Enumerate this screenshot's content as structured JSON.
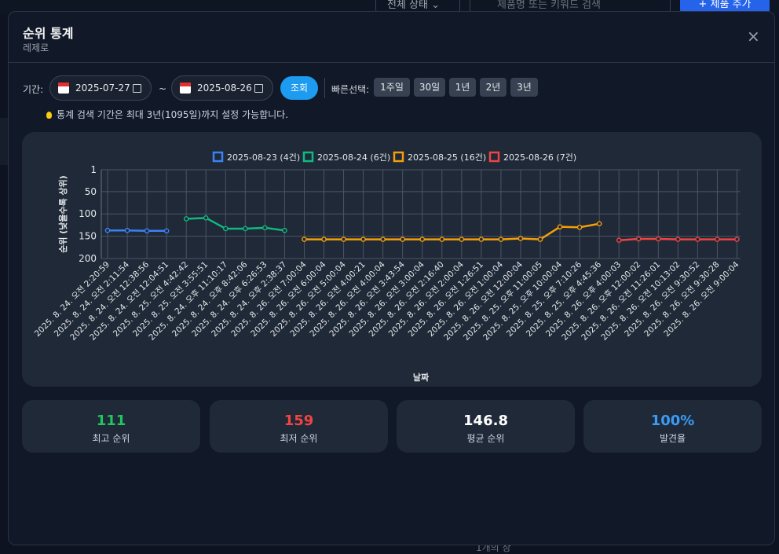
{
  "background": {
    "filter_label": "전체 상태 ⌄",
    "search_placeholder": "제품명 또는 키워드 검색",
    "add_button": "+ 제품 추가",
    "bottom_text": "1개의 상"
  },
  "modal": {
    "title": "순위 통계",
    "subtitle": "레제로",
    "close_icon": "×"
  },
  "filters": {
    "period_label": "기간:",
    "start_date": "2025-07-27",
    "end_date": "2025-08-26",
    "tilde": "~",
    "search_button": "조회",
    "quick_label": "빠른선택:",
    "quick_options": [
      "1주일",
      "30일",
      "1년",
      "2년",
      "3년"
    ],
    "hint": "통계 검색 기간은 최대 3년(1095일)까지 설정 가능합니다."
  },
  "chart_data": {
    "type": "line",
    "ylabel": "순위 (낮을수록 상위)",
    "xlabel": "날짜",
    "y_reversed": true,
    "ylim": [
      1,
      200
    ],
    "yticks": [
      1,
      50,
      100,
      150,
      200
    ],
    "grid": true,
    "legend_position": "top-center",
    "categories": [
      "2025. 8. 24. 오전 2:20:59",
      "2025. 8. 24. 오전 2:11:54",
      "2025. 8. 24. 오전 12:38:56",
      "2025. 8. 24. 오전 12:04:51",
      "2025. 8. 25. 오전 4:42:42",
      "2025. 8. 25. 오전 3:55:51",
      "2025. 8. 24. 오후 11:10:17",
      "2025. 8. 24. 오후 8:42:06",
      "2025. 8. 24. 오후 6:26:53",
      "2025. 8. 24. 오후 2:38:37",
      "2025. 8. 26. 오전 7:00:04",
      "2025. 8. 26. 오전 6:00:04",
      "2025. 8. 26. 오전 5:00:04",
      "2025. 8. 26. 오전 4:00:21",
      "2025. 8. 26. 오전 4:00:04",
      "2025. 8. 26. 오전 3:43:54",
      "2025. 8. 26. 오전 3:00:04",
      "2025. 8. 26. 오전 2:16:40",
      "2025. 8. 26. 오전 2:00:04",
      "2025. 8. 26. 오전 1:26:51",
      "2025. 8. 26. 오전 1:00:04",
      "2025. 8. 26. 오전 12:00:04",
      "2025. 8. 25. 오후 11:00:05",
      "2025. 8. 25. 오후 10:00:04",
      "2025. 8. 25. 오후 7:10:26",
      "2025. 8. 25. 오후 4:45:36",
      "2025. 8. 26. 오후 4:00:03",
      "2025. 8. 26. 오후 12:00:02",
      "2025. 8. 26. 오전 11:26:01",
      "2025. 8. 26. 오전 10:13:02",
      "2025. 8. 26. 오전 9:30:52",
      "2025. 8. 26. 오전 9:30:28",
      "2025. 8. 26. 오전 9:00:04"
    ],
    "series": [
      {
        "name": "2025-08-23 (4건)",
        "color": "#3b82f6",
        "start": 0,
        "values": [
          137,
          137,
          138,
          138
        ]
      },
      {
        "name": "2025-08-24 (6건)",
        "color": "#10b981",
        "start": 4,
        "values": [
          111,
          109,
          133,
          133,
          131,
          137
        ]
      },
      {
        "name": "2025-08-25 (16건)",
        "color": "#f59e0b",
        "start": 10,
        "values": [
          157,
          157,
          157,
          157,
          157,
          157,
          157,
          157,
          157,
          157,
          157,
          155,
          157,
          129,
          130,
          122
        ]
      },
      {
        "name": "2025-08-26 (7건)",
        "color": "#ef4444",
        "start": 26,
        "values": [
          159,
          156,
          156,
          157,
          157,
          157,
          157
        ]
      }
    ]
  },
  "stats": [
    {
      "value": "111",
      "label": "최고 순위",
      "color": "#22c55e"
    },
    {
      "value": "159",
      "label": "최저 순위",
      "color": "#ef4444"
    },
    {
      "value": "146.8",
      "label": "평균 순위",
      "color": "#ffffff"
    },
    {
      "value": "100%",
      "label": "발견율",
      "color": "#3b9cf6"
    }
  ]
}
